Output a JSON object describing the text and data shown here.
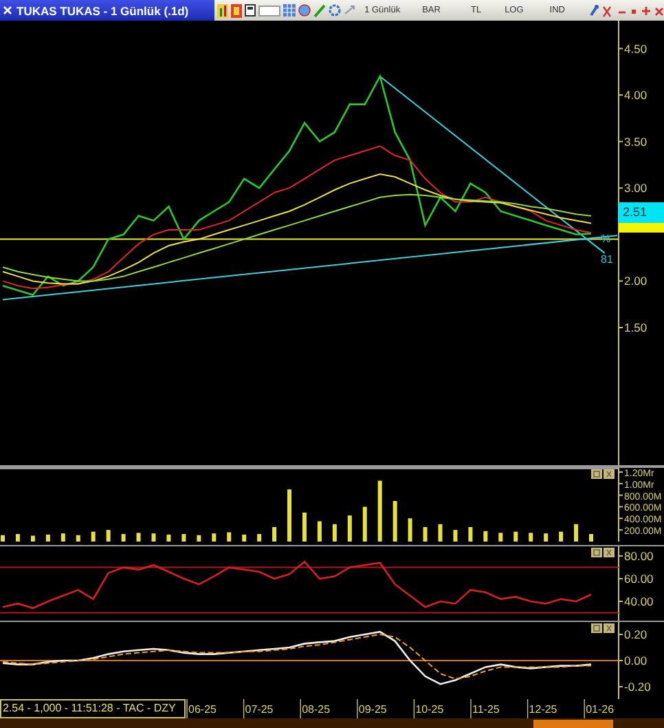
{
  "window": {
    "title": "TUKAS TUKAS - 1 Günlük (.1d)"
  },
  "toolbar": {
    "items": [
      {
        "label": "1 Günlük"
      },
      {
        "label": "BAR"
      },
      {
        "label": "TL"
      },
      {
        "label": "LOG"
      },
      {
        "label": "IND"
      }
    ]
  },
  "price_chart": {
    "chart_data": {
      "type": "line",
      "ylim": [
        0.02,
        4.8
      ],
      "yticks": [
        {
          "value": 1.5,
          "label": "1.50"
        },
        {
          "value": 2,
          "label": "2.00"
        },
        {
          "value": 3,
          "label": "3.00"
        },
        {
          "value": 3.5,
          "label": "3.50"
        },
        {
          "value": 4,
          "label": "4.00"
        },
        {
          "value": 4.5,
          "label": "4.50"
        }
      ],
      "series": [
        {
          "color": "#2cc82c",
          "values": [
            1.95,
            1.9,
            1.85,
            2.05,
            1.95,
            2.0,
            2.15,
            2.45,
            2.5,
            2.7,
            2.65,
            2.8,
            2.45,
            2.65,
            2.75,
            2.85,
            3.1,
            3.0,
            3.2,
            3.4,
            3.7,
            3.5,
            3.6,
            3.9,
            3.9,
            4.2,
            3.6,
            3.3,
            2.6,
            2.9,
            2.75,
            3.05,
            2.95,
            2.75,
            2.7,
            2.65,
            2.6,
            2.55,
            2.5,
            2.51
          ]
        },
        {
          "color": "#e02828",
          "values": [
            2.0,
            1.95,
            1.92,
            1.93,
            1.96,
            1.97,
            2.02,
            2.1,
            2.25,
            2.4,
            2.5,
            2.55,
            2.55,
            2.55,
            2.6,
            2.65,
            2.75,
            2.85,
            2.95,
            3.0,
            3.1,
            3.2,
            3.3,
            3.35,
            3.4,
            3.45,
            3.35,
            3.3,
            3.1,
            2.95,
            2.85,
            2.85,
            2.9,
            2.85,
            2.8,
            2.75,
            2.65,
            2.6,
            2.55,
            2.52
          ]
        },
        {
          "color": "#e8e050",
          "values": [
            2.1,
            2.05,
            2.0,
            1.98,
            1.97,
            1.97,
            2.0,
            2.05,
            2.12,
            2.2,
            2.3,
            2.38,
            2.42,
            2.45,
            2.5,
            2.55,
            2.6,
            2.65,
            2.7,
            2.75,
            2.82,
            2.9,
            2.98,
            3.05,
            3.1,
            3.15,
            3.12,
            3.05,
            2.98,
            2.92,
            2.88,
            2.86,
            2.85,
            2.84,
            2.8,
            2.76,
            2.72,
            2.68,
            2.65,
            2.62
          ]
        },
        {
          "color": "#90d848",
          "values": [
            2.15,
            2.1,
            2.07,
            2.04,
            2.02,
            2.0,
            2.0,
            2.02,
            2.05,
            2.1,
            2.15,
            2.2,
            2.25,
            2.3,
            2.35,
            2.4,
            2.45,
            2.5,
            2.55,
            2.6,
            2.65,
            2.7,
            2.75,
            2.8,
            2.85,
            2.9,
            2.92,
            2.93,
            2.92,
            2.9,
            2.88,
            2.87,
            2.86,
            2.85,
            2.83,
            2.8,
            2.78,
            2.75,
            2.72,
            2.7
          ]
        }
      ],
      "ref_lines": [
        {
          "axis": "y",
          "value": 2.45,
          "color": "#e8e830"
        }
      ]
    },
    "price_tags": [
      {
        "label": "2.51",
        "color": "#00e4f4"
      },
      {
        "color": "#f4f400"
      }
    ],
    "trend_labels": [
      "%",
      "81"
    ]
  },
  "volume_chart": {
    "chart_data": {
      "type": "bar",
      "ylim": [
        0,
        1271
      ],
      "yticks": [
        {
          "value": 200,
          "label": "200.00M"
        },
        {
          "value": 400,
          "label": "400.00M"
        },
        {
          "value": 600,
          "label": "600.00M"
        },
        {
          "value": 800,
          "label": "800.00M"
        }
      ],
      "series": [
        {
          "color": "#e8e040",
          "values": [
            110,
            130,
            100,
            120,
            140,
            110,
            170,
            200,
            130,
            150,
            140,
            120,
            130,
            110,
            140,
            160,
            120,
            130,
            250,
            900,
            500,
            350,
            300,
            450,
            600,
            1050,
            700,
            400,
            250,
            300,
            200,
            250,
            180,
            150,
            170,
            150,
            140,
            170,
            300,
            130
          ]
        }
      ]
    },
    "upper_axis_labels": [
      "1.20Mr",
      "1.00Mr"
    ]
  },
  "rsi_chart": {
    "chart_data": {
      "type": "line",
      "ylim": [
        23,
        88.5
      ],
      "yticks": [
        {
          "value": 40,
          "label": "40.00"
        },
        {
          "value": 60,
          "label": "60.00"
        },
        {
          "value": 80,
          "label": "80.00"
        }
      ],
      "series": [
        {
          "color": "#d82020",
          "values": [
            35,
            38,
            34,
            40,
            45,
            50,
            42,
            65,
            70,
            68,
            72,
            66,
            60,
            55,
            62,
            70,
            68,
            66,
            60,
            64,
            75,
            60,
            62,
            70,
            72,
            74,
            55,
            45,
            35,
            40,
            38,
            50,
            48,
            42,
            44,
            40,
            38,
            42,
            40,
            46
          ]
        }
      ],
      "ref_lines": [
        {
          "axis": "y",
          "value": 70,
          "color": "#b01818"
        },
        {
          "axis": "y",
          "value": 30,
          "color": "#b01818"
        }
      ]
    }
  },
  "macd_chart": {
    "chart_data": {
      "type": "line",
      "ylim": [
        -0.295,
        0.295
      ],
      "yticks": [
        {
          "value": -0.2,
          "label": "-0.20"
        },
        {
          "value": 0,
          "label": "0.00"
        },
        {
          "value": 0.2,
          "label": "0.20"
        }
      ],
      "series": [
        {
          "color": "#f0f0f0",
          "values": [
            -0.02,
            -0.03,
            -0.03,
            -0.01,
            0.0,
            0.0,
            0.02,
            0.05,
            0.07,
            0.08,
            0.09,
            0.08,
            0.06,
            0.05,
            0.05,
            0.06,
            0.07,
            0.08,
            0.09,
            0.1,
            0.13,
            0.14,
            0.15,
            0.18,
            0.2,
            0.22,
            0.15,
            0.0,
            -0.12,
            -0.18,
            -0.15,
            -0.1,
            -0.05,
            -0.03,
            -0.05,
            -0.06,
            -0.05,
            -0.04,
            -0.04,
            -0.03
          ]
        },
        {
          "color": "#f0a020",
          "line_style": "dashed",
          "values": [
            -0.01,
            -0.02,
            -0.03,
            -0.02,
            -0.01,
            0.0,
            0.01,
            0.03,
            0.05,
            0.06,
            0.07,
            0.08,
            0.07,
            0.06,
            0.06,
            0.06,
            0.07,
            0.07,
            0.08,
            0.09,
            0.11,
            0.12,
            0.14,
            0.16,
            0.18,
            0.2,
            0.18,
            0.1,
            0.0,
            -0.1,
            -0.14,
            -0.12,
            -0.08,
            -0.05,
            -0.05,
            -0.05,
            -0.05,
            -0.05,
            -0.04,
            -0.04
          ]
        }
      ],
      "ref_lines": [
        {
          "axis": "y",
          "value": 0,
          "color": "#e07010"
        }
      ]
    }
  },
  "status_bar": {
    "text": "2.54 - 1,000 - 11:51:28 - TAC - DZY"
  },
  "time_axis": {
    "labels": [
      "06-25",
      "07-25",
      "08-25",
      "09-25",
      "10-25",
      "11-25",
      "12-25",
      "01-26"
    ]
  }
}
